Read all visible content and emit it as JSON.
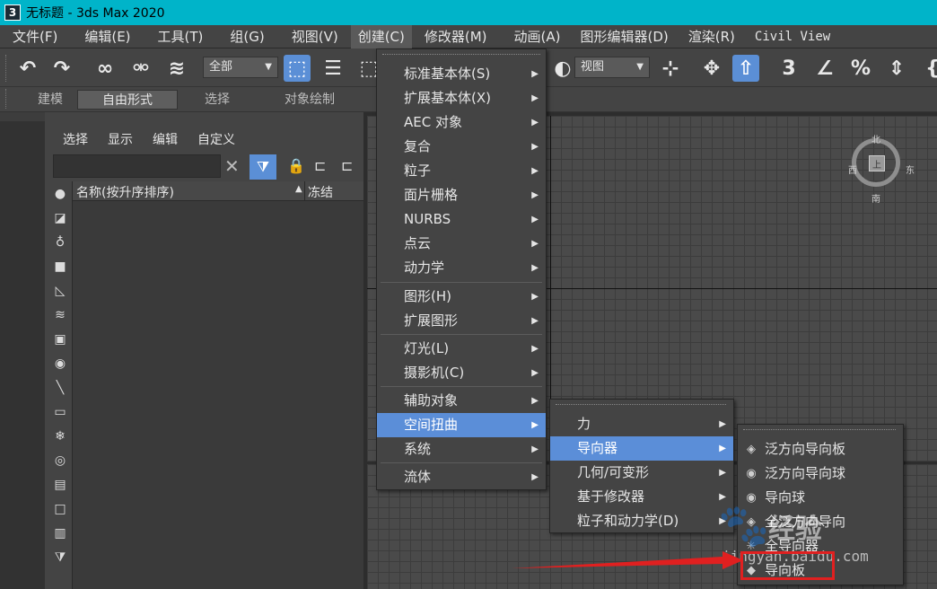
{
  "window": {
    "icon_text": "3",
    "title": "无标题 - 3ds Max 2020"
  },
  "menubar": [
    "文件(F)",
    "编辑(E)",
    "工具(T)",
    "组(G)",
    "视图(V)",
    "创建(C)",
    "修改器(M)",
    "动画(A)",
    "图形编辑器(D)",
    "渲染(R)",
    "Civil View"
  ],
  "toolbar": {
    "selection_filter": "全部",
    "ref_coord": "视图"
  },
  "ribbon_tabs": [
    "建模",
    "自由形式",
    "选择",
    "对象绘制"
  ],
  "scene_explorer": {
    "tabs": [
      "选择",
      "显示",
      "编辑",
      "自定义"
    ],
    "col_name": "名称(按升序排序)",
    "sort_glyph": "▲",
    "col_frozen": "冻结",
    "clear_glyph": "✕"
  },
  "viewcube": {
    "north": "北",
    "south": "南",
    "east": "东",
    "west": "西",
    "face": "上"
  },
  "create_menu": {
    "items": [
      {
        "label": "标准基本体(S)"
      },
      {
        "label": "扩展基本体(X)"
      },
      {
        "label": "AEC 对象"
      },
      {
        "label": "复合"
      },
      {
        "label": "粒子"
      },
      {
        "label": "面片栅格"
      },
      {
        "label": "NURBS"
      },
      {
        "label": "点云"
      },
      {
        "label": "动力学"
      },
      {
        "label": "图形(H)"
      },
      {
        "label": "扩展图形"
      },
      {
        "label": "灯光(L)"
      },
      {
        "label": "摄影机(C)"
      },
      {
        "label": "辅助对象"
      },
      {
        "label": "空间扭曲"
      },
      {
        "label": "系统"
      },
      {
        "label": "流体"
      }
    ],
    "highlighted": "空间扭曲"
  },
  "spacewarp_menu": {
    "items": [
      "力",
      "导向器",
      "几何/可变形",
      "基于修改器",
      "粒子和动力学(D)"
    ],
    "highlighted": "导向器"
  },
  "deflector_menu": {
    "items": [
      "泛方向导向板",
      "泛方向导向球",
      "导向球",
      "全泛方向导向",
      "全导向器",
      "导向板"
    ]
  },
  "watermark": {
    "brand": "Bai",
    "text": "经验",
    "url": "jingyan.baidu.com"
  },
  "colors": {
    "titlebar": "#00b4c9",
    "highlight": "#5b8ed8",
    "annotation": "#e02020"
  }
}
